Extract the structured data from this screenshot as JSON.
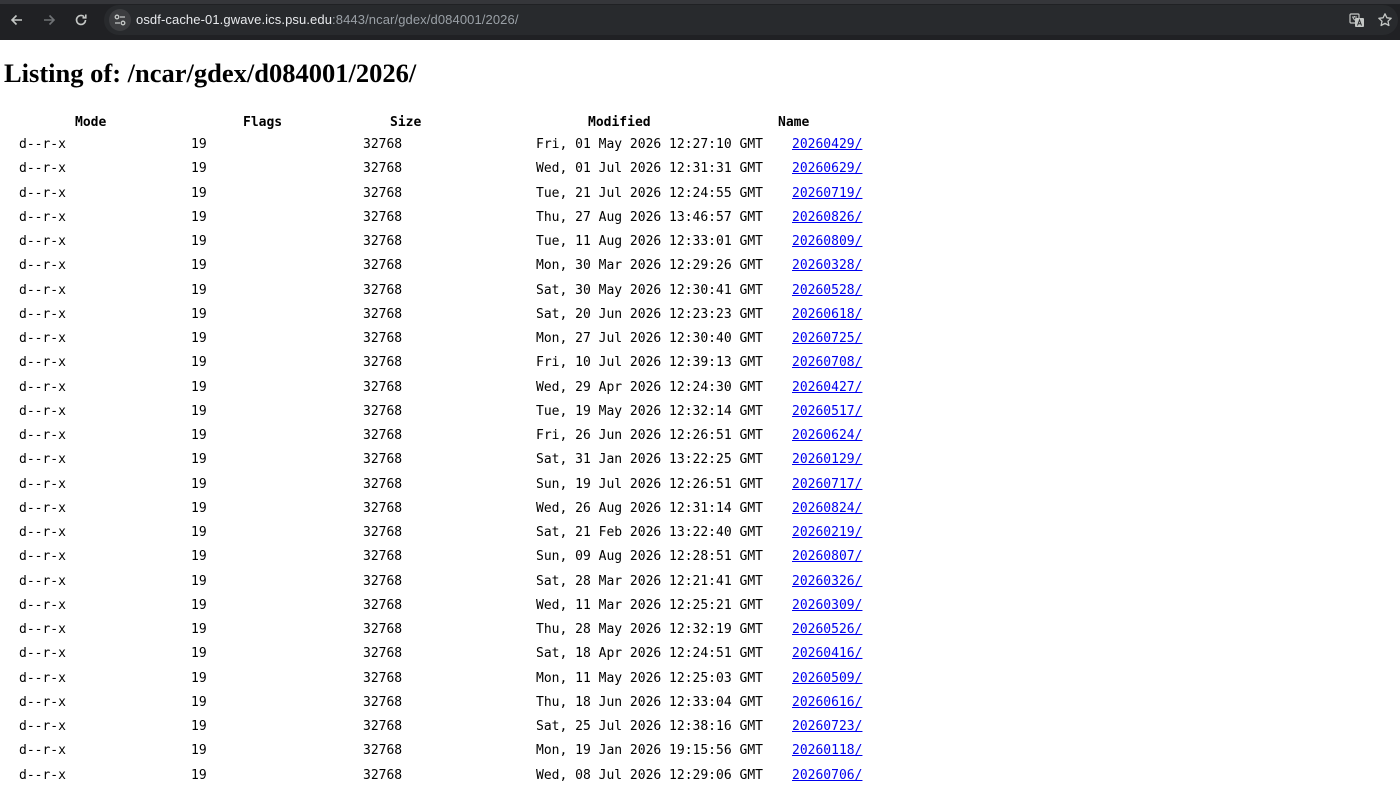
{
  "browser": {
    "url_host": "osdf-cache-01.gwave.ics.psu.edu",
    "url_path": ":8443/ncar/gdex/d084001/2026/",
    "back_icon": "arrow-left-icon",
    "forward_icon": "arrow-right-icon",
    "reload_icon": "reload-icon",
    "site_info_icon": "tune-icon",
    "translate_icon": "translate-icon",
    "bookmark_icon": "star-icon",
    "colors": {
      "chrome": "#202124",
      "omnibox": "#282a2d",
      "link": "#0000ee"
    }
  },
  "page": {
    "title": "Listing of: /ncar/gdex/d084001/2026/",
    "headers": {
      "mode": "Mode",
      "flags": "Flags",
      "size": "Size",
      "modified": "Modified",
      "name": "Name"
    },
    "rows": [
      {
        "mode": "d--r-x",
        "flags": "19",
        "size": "32768",
        "modified": "Fri, 01 May 2026 12:27:10 GMT",
        "name": "20260429/"
      },
      {
        "mode": "d--r-x",
        "flags": "19",
        "size": "32768",
        "modified": "Wed, 01 Jul 2026 12:31:31 GMT",
        "name": "20260629/"
      },
      {
        "mode": "d--r-x",
        "flags": "19",
        "size": "32768",
        "modified": "Tue, 21 Jul 2026 12:24:55 GMT",
        "name": "20260719/"
      },
      {
        "mode": "d--r-x",
        "flags": "19",
        "size": "32768",
        "modified": "Thu, 27 Aug 2026 13:46:57 GMT",
        "name": "20260826/"
      },
      {
        "mode": "d--r-x",
        "flags": "19",
        "size": "32768",
        "modified": "Tue, 11 Aug 2026 12:33:01 GMT",
        "name": "20260809/"
      },
      {
        "mode": "d--r-x",
        "flags": "19",
        "size": "32768",
        "modified": "Mon, 30 Mar 2026 12:29:26 GMT",
        "name": "20260328/"
      },
      {
        "mode": "d--r-x",
        "flags": "19",
        "size": "32768",
        "modified": "Sat, 30 May 2026 12:30:41 GMT",
        "name": "20260528/"
      },
      {
        "mode": "d--r-x",
        "flags": "19",
        "size": "32768",
        "modified": "Sat, 20 Jun 2026 12:23:23 GMT",
        "name": "20260618/"
      },
      {
        "mode": "d--r-x",
        "flags": "19",
        "size": "32768",
        "modified": "Mon, 27 Jul 2026 12:30:40 GMT",
        "name": "20260725/"
      },
      {
        "mode": "d--r-x",
        "flags": "19",
        "size": "32768",
        "modified": "Fri, 10 Jul 2026 12:39:13 GMT",
        "name": "20260708/"
      },
      {
        "mode": "d--r-x",
        "flags": "19",
        "size": "32768",
        "modified": "Wed, 29 Apr 2026 12:24:30 GMT",
        "name": "20260427/"
      },
      {
        "mode": "d--r-x",
        "flags": "19",
        "size": "32768",
        "modified": "Tue, 19 May 2026 12:32:14 GMT",
        "name": "20260517/"
      },
      {
        "mode": "d--r-x",
        "flags": "19",
        "size": "32768",
        "modified": "Fri, 26 Jun 2026 12:26:51 GMT",
        "name": "20260624/"
      },
      {
        "mode": "d--r-x",
        "flags": "19",
        "size": "32768",
        "modified": "Sat, 31 Jan 2026 13:22:25 GMT",
        "name": "20260129/"
      },
      {
        "mode": "d--r-x",
        "flags": "19",
        "size": "32768",
        "modified": "Sun, 19 Jul 2026 12:26:51 GMT",
        "name": "20260717/"
      },
      {
        "mode": "d--r-x",
        "flags": "19",
        "size": "32768",
        "modified": "Wed, 26 Aug 2026 12:31:14 GMT",
        "name": "20260824/"
      },
      {
        "mode": "d--r-x",
        "flags": "19",
        "size": "32768",
        "modified": "Sat, 21 Feb 2026 13:22:40 GMT",
        "name": "20260219/"
      },
      {
        "mode": "d--r-x",
        "flags": "19",
        "size": "32768",
        "modified": "Sun, 09 Aug 2026 12:28:51 GMT",
        "name": "20260807/"
      },
      {
        "mode": "d--r-x",
        "flags": "19",
        "size": "32768",
        "modified": "Sat, 28 Mar 2026 12:21:41 GMT",
        "name": "20260326/"
      },
      {
        "mode": "d--r-x",
        "flags": "19",
        "size": "32768",
        "modified": "Wed, 11 Mar 2026 12:25:21 GMT",
        "name": "20260309/"
      },
      {
        "mode": "d--r-x",
        "flags": "19",
        "size": "32768",
        "modified": "Thu, 28 May 2026 12:32:19 GMT",
        "name": "20260526/"
      },
      {
        "mode": "d--r-x",
        "flags": "19",
        "size": "32768",
        "modified": "Sat, 18 Apr 2026 12:24:51 GMT",
        "name": "20260416/"
      },
      {
        "mode": "d--r-x",
        "flags": "19",
        "size": "32768",
        "modified": "Mon, 11 May 2026 12:25:03 GMT",
        "name": "20260509/"
      },
      {
        "mode": "d--r-x",
        "flags": "19",
        "size": "32768",
        "modified": "Thu, 18 Jun 2026 12:33:04 GMT",
        "name": "20260616/"
      },
      {
        "mode": "d--r-x",
        "flags": "19",
        "size": "32768",
        "modified": "Sat, 25 Jul 2026 12:38:16 GMT",
        "name": "20260723/"
      },
      {
        "mode": "d--r-x",
        "flags": "19",
        "size": "32768",
        "modified": "Mon, 19 Jan 2026 19:15:56 GMT",
        "name": "20260118/"
      },
      {
        "mode": "d--r-x",
        "flags": "19",
        "size": "32768",
        "modified": "Wed, 08 Jul 2026 12:29:06 GMT",
        "name": "20260706/"
      }
    ]
  }
}
